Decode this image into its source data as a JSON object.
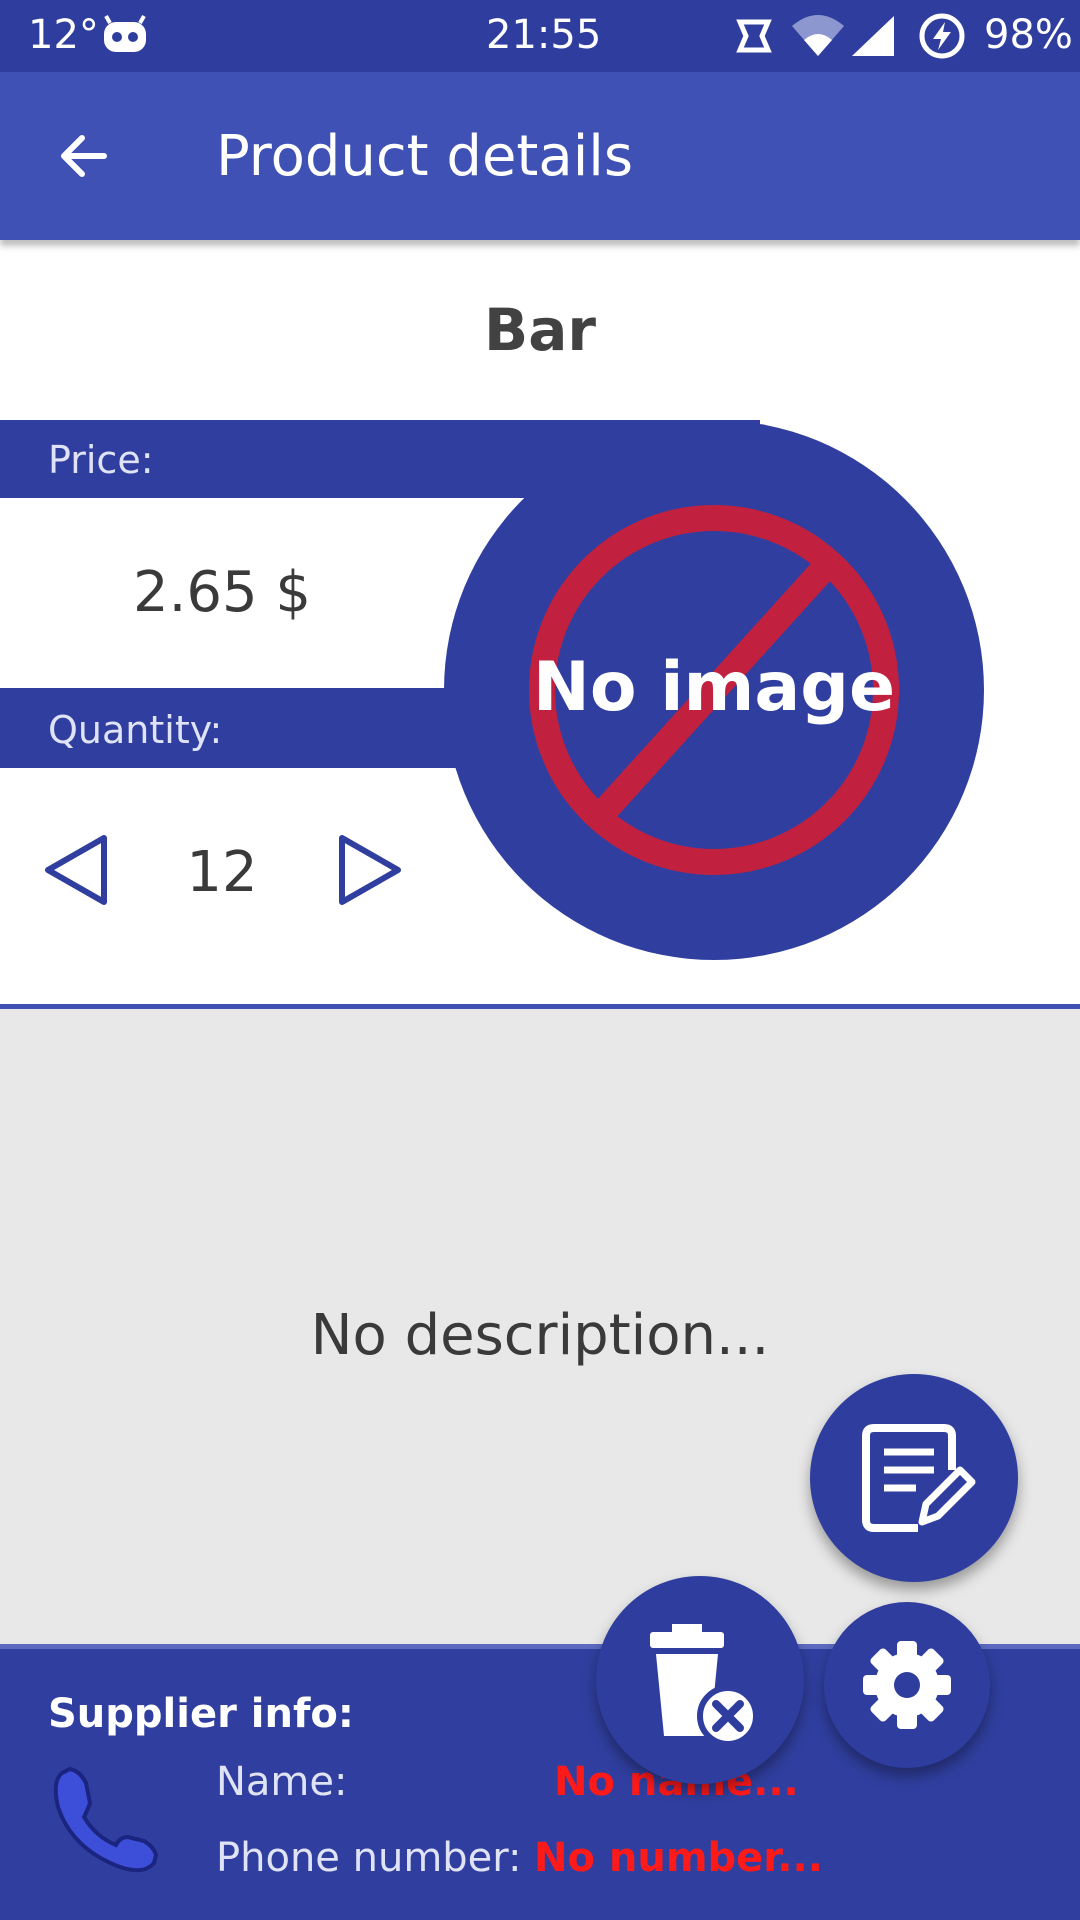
{
  "status_bar": {
    "temperature": "12°",
    "time": "21:55",
    "battery": "98%"
  },
  "app_bar": {
    "title": "Product details",
    "back_icon": "arrow-left-icon"
  },
  "product": {
    "name": "Bar",
    "price_label": "Price:",
    "price_value": "2.65 $",
    "quantity_label": "Quantity:",
    "quantity_value": "12",
    "image_placeholder_text": "No image"
  },
  "description": {
    "text": "No description..."
  },
  "supplier": {
    "header": "Supplier info:",
    "name_label": "Name:",
    "name_value": "No name...",
    "phone_label": "Phone number:",
    "phone_value": "No number..."
  },
  "colors": {
    "primary": "#3f51b5",
    "primary_dark": "#303f9f",
    "accent_red": "#ff1a1a",
    "no_image_ring": "#c2203f"
  }
}
